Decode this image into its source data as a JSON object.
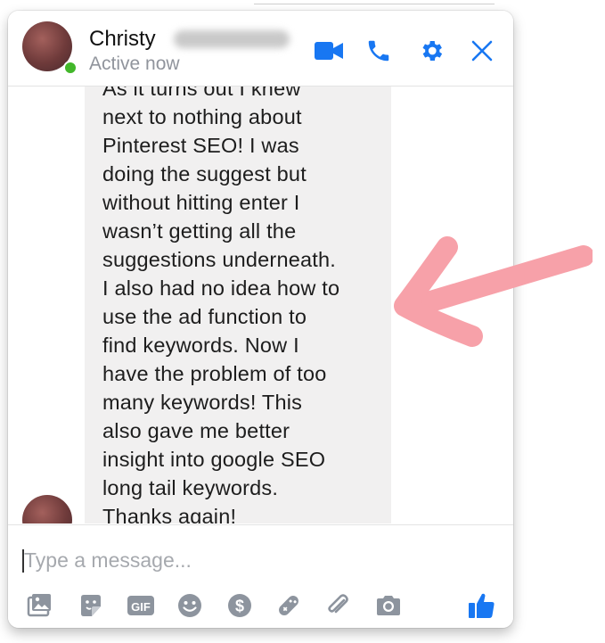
{
  "contact": {
    "first_name": "Christy",
    "status": "Active now"
  },
  "header_icons": [
    "video-camera-icon",
    "phone-icon",
    "gear-icon",
    "close-icon"
  ],
  "message": {
    "text": "As it turns out I knew\nnext to nothing about\nPinterest SEO! I was\ndoing the suggest but\nwithout hitting enter I\nwasn’t getting all the\nsuggestions underneath.\nI also had no idea how to\nuse the ad function to\nfind keywords. Now I\nhave the problem of too\nmany keywords! This\nalso gave me better\ninsight into google SEO\nlong tail keywords.\nThanks again!"
  },
  "composer": {
    "placeholder": "Type a message..."
  },
  "toolbar_icons": [
    "photo-icon",
    "sticker-icon",
    "gif-icon",
    "emoji-icon",
    "payment-icon",
    "game-icon",
    "attachment-icon",
    "camera-icon",
    "like-icon"
  ],
  "colors": {
    "accent": "#1877f2",
    "bubble": "#f1f0f0",
    "toolbar_icon": "#8d949e",
    "annotation_arrow": "#f7a1a9",
    "online": "#42b72a"
  }
}
